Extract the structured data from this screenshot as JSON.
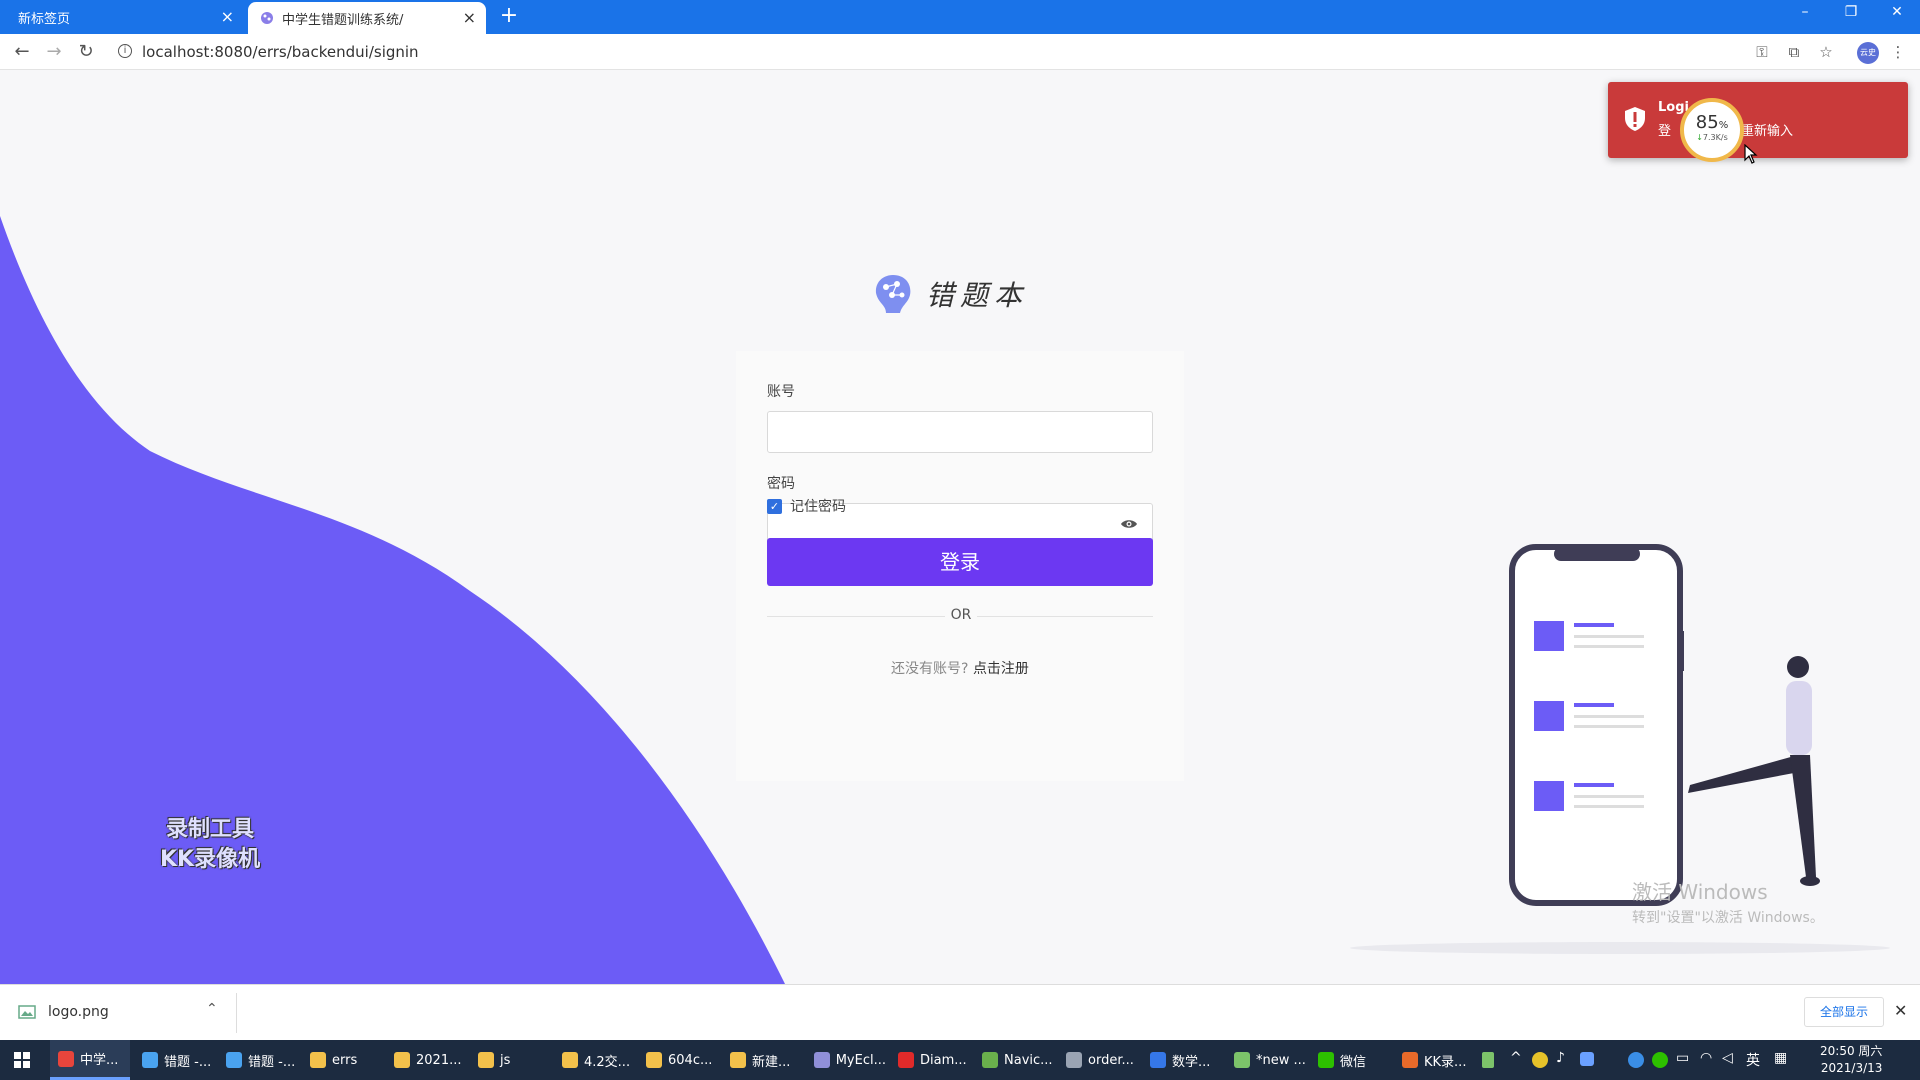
{
  "browser": {
    "tabs": [
      {
        "title": "新标签页",
        "active": false
      },
      {
        "title": "中学生错题训练系统/",
        "active": true
      }
    ],
    "new_tab": "+",
    "url": "localhost:8080/errs/backendui/signin",
    "profile_label": "云史"
  },
  "logo": {
    "text": "错题本"
  },
  "form": {
    "account_label": "账号",
    "account_value": "",
    "password_label": "密码",
    "password_value": "",
    "remember_label": "记住密码",
    "remember_checked": true,
    "login_button": "登录",
    "divider_text": "OR",
    "register_prompt": "还没有账号?",
    "register_link": "点击注册"
  },
  "toast": {
    "title": "Logi",
    "message_start": "登",
    "message_end": "重新输入",
    "color": "#c93a3a"
  },
  "speed_widget": {
    "percent": "85",
    "percent_unit": "%",
    "rate": "7.3K/s"
  },
  "watermark": {
    "line1": "录制工具",
    "line2": "KK录像机"
  },
  "activation": {
    "line1": "激活 Windows",
    "line2": "转到\"设置\"以激活 Windows。"
  },
  "download_bar": {
    "file": "logo.png",
    "show_all": "全部显示"
  },
  "taskbar": {
    "items": [
      {
        "label": "中学...",
        "icon": "chrome-icon",
        "color": "#e8453c",
        "active": true
      },
      {
        "label": "错题 -...",
        "icon": "app-icon",
        "color": "#4aa3f0"
      },
      {
        "label": "错题 -...",
        "icon": "app-icon",
        "color": "#4aa3f0"
      },
      {
        "label": "errs",
        "icon": "folder-icon",
        "color": "#f3c14b"
      },
      {
        "label": "2021...",
        "icon": "folder-icon",
        "color": "#f3c14b"
      },
      {
        "label": "js",
        "icon": "folder-icon",
        "color": "#f3c14b"
      },
      {
        "label": "4.2交...",
        "icon": "folder-icon",
        "color": "#f3c14b"
      },
      {
        "label": "604c...",
        "icon": "folder-icon",
        "color": "#f3c14b"
      },
      {
        "label": "新建...",
        "icon": "folder-icon",
        "color": "#f3c14b"
      },
      {
        "label": "MyEcl...",
        "icon": "eclipse-icon",
        "color": "#8f8fd8"
      },
      {
        "label": "Diam...",
        "icon": "diamond-icon",
        "color": "#e02a2a"
      },
      {
        "label": "Navic...",
        "icon": "navicat-icon",
        "color": "#6ab04c"
      },
      {
        "label": "order...",
        "icon": "app-icon",
        "color": "#9aa4b3"
      },
      {
        "label": "数学...",
        "icon": "editor-icon",
        "color": "#3577e8"
      },
      {
        "label": "*new ...",
        "icon": "notepad-icon",
        "color": "#7cc36a"
      },
      {
        "label": "微信",
        "icon": "wechat-icon",
        "color": "#2dc100"
      },
      {
        "label": "KK录...",
        "icon": "recorder-icon",
        "color": "#e86a2a"
      }
    ],
    "tray_lang": "英",
    "time": "20:50 周六",
    "date": "2021/3/13"
  }
}
